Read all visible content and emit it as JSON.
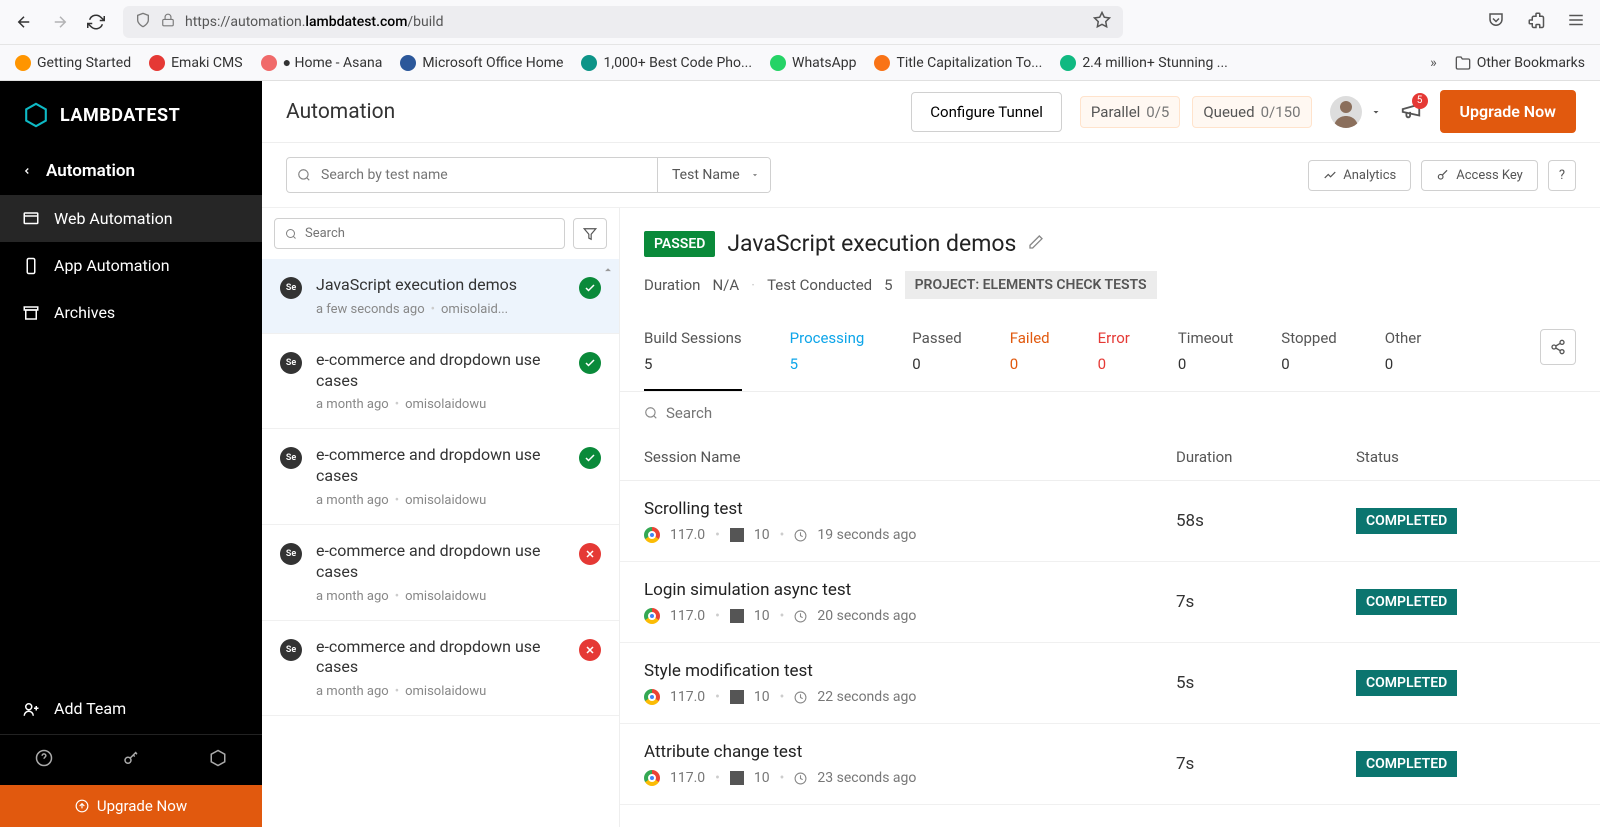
{
  "browser": {
    "url_prefix": "https://automation.",
    "url_domain": "lambdatest.com",
    "url_path": "/build"
  },
  "bookmarks": [
    {
      "label": "Getting Started",
      "color": "#ff9500"
    },
    {
      "label": "Emaki CMS",
      "color": "#e53935"
    },
    {
      "label": "● Home - Asana",
      "color": "#f06a6a"
    },
    {
      "label": "Microsoft Office Home",
      "color": "#2b579a"
    },
    {
      "label": "1,000+ Best Code Pho...",
      "color": "#0d9488"
    },
    {
      "label": "WhatsApp",
      "color": "#25d366"
    },
    {
      "label": "Title Capitalization To...",
      "color": "#f97316"
    },
    {
      "label": "2.4 million+ Stunning ...",
      "color": "#10b981"
    }
  ],
  "other_bookmarks": "Other Bookmarks",
  "logo": "LAMBDATEST",
  "sidebar": {
    "head": "Automation",
    "items": [
      "Web Automation",
      "App Automation",
      "Archives"
    ],
    "add_team": "Add Team",
    "upgrade": "Upgrade Now"
  },
  "topbar": {
    "title": "Automation",
    "configure": "Configure Tunnel",
    "parallel_label": "Parallel",
    "parallel_val": "0/5",
    "queued_label": "Queued",
    "queued_val": "0/150",
    "notif_count": "5",
    "upgrade": "Upgrade Now"
  },
  "search": {
    "placeholder": "Search by test name",
    "select": "Test Name",
    "analytics": "Analytics",
    "access_key": "Access Key",
    "help": "?"
  },
  "builds_search_placeholder": "Search",
  "builds": [
    {
      "name": "JavaScript execution demos",
      "time": "a few seconds ago",
      "user": "omisolaid...",
      "status": "pass",
      "selected": true
    },
    {
      "name": "e-commerce and dropdown use cases",
      "time": "a month ago",
      "user": "omisolaidowu",
      "status": "pass"
    },
    {
      "name": "e-commerce and dropdown use cases",
      "time": "a month ago",
      "user": "omisolaidowu",
      "status": "pass"
    },
    {
      "name": "e-commerce and dropdown use cases",
      "time": "a month ago",
      "user": "omisolaidowu",
      "status": "fail"
    },
    {
      "name": "e-commerce and dropdown use cases",
      "time": "a month ago",
      "user": "omisolaidowu",
      "status": "fail"
    }
  ],
  "detail": {
    "badge": "PASSED",
    "title": "JavaScript execution demos",
    "duration_label": "Duration",
    "duration_val": "N/A",
    "conducted_label": "Test Conducted",
    "conducted_val": "5",
    "project": "PROJECT: ELEMENTS CHECK TESTS",
    "tabs": [
      {
        "label": "Build Sessions",
        "count": "5",
        "cls": "active"
      },
      {
        "label": "Processing",
        "count": "5",
        "cls": "processing"
      },
      {
        "label": "Passed",
        "count": "0",
        "cls": ""
      },
      {
        "label": "Failed",
        "count": "0",
        "cls": "failed"
      },
      {
        "label": "Error",
        "count": "0",
        "cls": "error"
      },
      {
        "label": "Timeout",
        "count": "0",
        "cls": ""
      },
      {
        "label": "Stopped",
        "count": "0",
        "cls": ""
      },
      {
        "label": "Other",
        "count": "0",
        "cls": ""
      }
    ],
    "session_search": "Search",
    "columns": {
      "name": "Session Name",
      "duration": "Duration",
      "status": "Status"
    },
    "sessions": [
      {
        "name": "Scrolling test",
        "browser": "117.0",
        "os": "10",
        "time": "19 seconds ago",
        "duration": "58s",
        "status": "COMPLETED"
      },
      {
        "name": "Login simulation async test",
        "browser": "117.0",
        "os": "10",
        "time": "20 seconds ago",
        "duration": "7s",
        "status": "COMPLETED"
      },
      {
        "name": "Style modification test",
        "browser": "117.0",
        "os": "10",
        "time": "22 seconds ago",
        "duration": "5s",
        "status": "COMPLETED"
      },
      {
        "name": "Attribute change test",
        "browser": "117.0",
        "os": "10",
        "time": "23 seconds ago",
        "duration": "7s",
        "status": "COMPLETED"
      }
    ]
  }
}
